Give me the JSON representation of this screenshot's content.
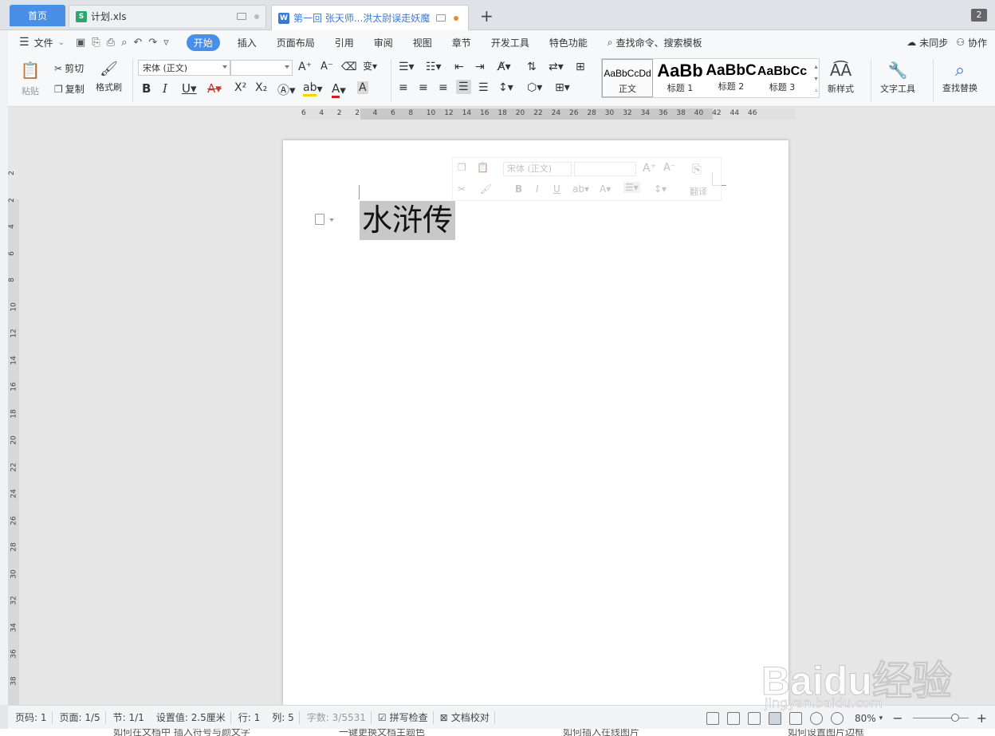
{
  "tabs": {
    "home": "首页",
    "file1": {
      "name": "计划.xls",
      "icon": "S"
    },
    "file2": {
      "name": "第一回 张天师...洪太尉误走妖魔",
      "icon": "W"
    },
    "new_tab": "+",
    "window_count": "2"
  },
  "menu": {
    "file": "文件",
    "items": [
      "开始",
      "插入",
      "页面布局",
      "引用",
      "审阅",
      "视图",
      "章节",
      "开发工具",
      "特色功能"
    ],
    "search": "查找命令、搜索模板",
    "sync": "未同步",
    "collab": "协作"
  },
  "ribbon": {
    "paste": "粘贴",
    "cut": "剪切",
    "copy": "复制",
    "format_painter": "格式刷",
    "font_name": "宋体 (正文)",
    "font_size": "",
    "styles": [
      {
        "preview": "AaBbCcDd",
        "label": "正文"
      },
      {
        "preview": "AaBb",
        "label": "标题 1"
      },
      {
        "preview": "AaBbC",
        "label": "标题 2"
      },
      {
        "preview": "AaBbCc",
        "label": "标题 3"
      }
    ],
    "new_style": "新样式",
    "text_tools": "文字工具",
    "find_replace": "查找替换"
  },
  "ruler": {
    "h_ticks": [
      "6",
      "4",
      "2",
      "2",
      "4",
      "6",
      "8",
      "10",
      "12",
      "14",
      "16",
      "18",
      "20",
      "22",
      "24",
      "26",
      "28",
      "30",
      "32",
      "34",
      "36",
      "38",
      "40",
      "42",
      "44",
      "46"
    ],
    "v_ticks": [
      "2",
      "2",
      "4",
      "6",
      "8",
      "10",
      "12",
      "14",
      "16",
      "18",
      "20",
      "22",
      "24",
      "26",
      "28",
      "30",
      "32",
      "34",
      "36",
      "38"
    ]
  },
  "document": {
    "title": "水浒传"
  },
  "mini_toolbar": {
    "font_name": "宋体 (正文)",
    "translate": "翻译"
  },
  "status": {
    "page_num": "页码: 1",
    "pages": "页面: 1/5",
    "section": "节: 1/1",
    "setting": "设置值: 2.5厘米",
    "row": "行: 1",
    "col": "列: 5",
    "word_count": "字数: 3/5531",
    "spell_check": "拼写检查",
    "doc_proof": "文档校对",
    "zoom": "80%"
  },
  "bottom_links": [
    "如何在文档中 插入符号与颜文字",
    "一键更换文档主题色",
    "如何插入在线图片",
    "如何设置图片边框"
  ],
  "watermark": {
    "brand": "Baidu经验",
    "url": "jingyan.baidu.com"
  },
  "colors": {
    "accent": "#4a8fe7",
    "tab_active_text": "#3b78d8",
    "selection": "#c8c8c8"
  }
}
